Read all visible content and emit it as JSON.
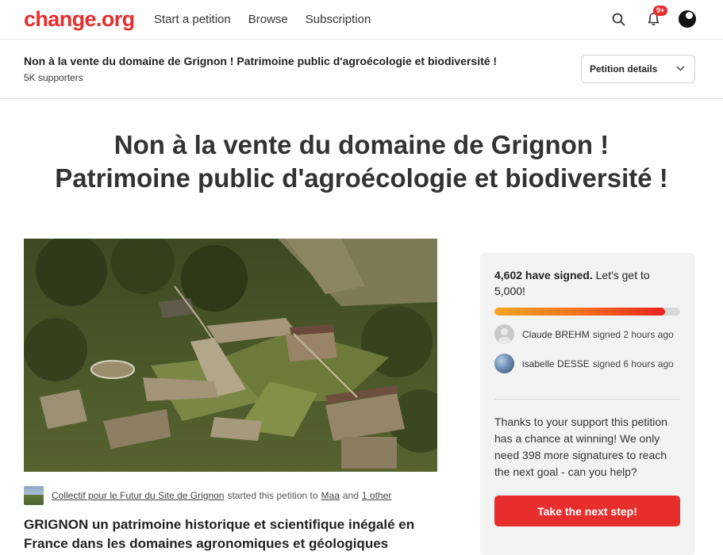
{
  "nav": {
    "logo": "change.org",
    "links": [
      "Start a petition",
      "Browse",
      "Subscription"
    ],
    "notification_badge": "9+",
    "icons": [
      "search-icon",
      "bell-icon",
      "user-avatar"
    ]
  },
  "petition_bar": {
    "title": "Non à la vente du domaine de Grignon ! Patrimoine public d'agroécologie et biodiversité !",
    "supporters": "5K supporters",
    "details_label": "Petition details"
  },
  "main": {
    "title_line1": "Non à la vente du domaine de Grignon !",
    "title_line2": "Patrimoine public d'agroécologie et biodiversité !",
    "starter": {
      "author": "Collectif pour le Futur du Site de Grignon",
      "action": "started this petition to",
      "target": "Maa",
      "conjunction": "and",
      "other": "1 other"
    },
    "body_heading": "GRIGNON un patrimoine historique et scientifique inégalé en France dans les domaines agronomiques et géologiques"
  },
  "sidebar": {
    "signed_count": "4,602 have signed.",
    "goal_text": "Let's get to 5,000!",
    "progress_fraction": 0.9204,
    "recent_signers": [
      {
        "name": "Claude BREHM",
        "text": "signed 2 hours ago"
      },
      {
        "name": "isabelle DESSE",
        "text": "signed 6 hours ago"
      }
    ],
    "support_text": "Thanks to your support this petition has a chance at winning! We only need 398 more signatures to reach the next goal - can you help?",
    "cta_label": "Take the next step!"
  },
  "colors": {
    "brand": "#e82d2d",
    "progress_start": "#f5a623",
    "progress_end": "#e8231f"
  }
}
